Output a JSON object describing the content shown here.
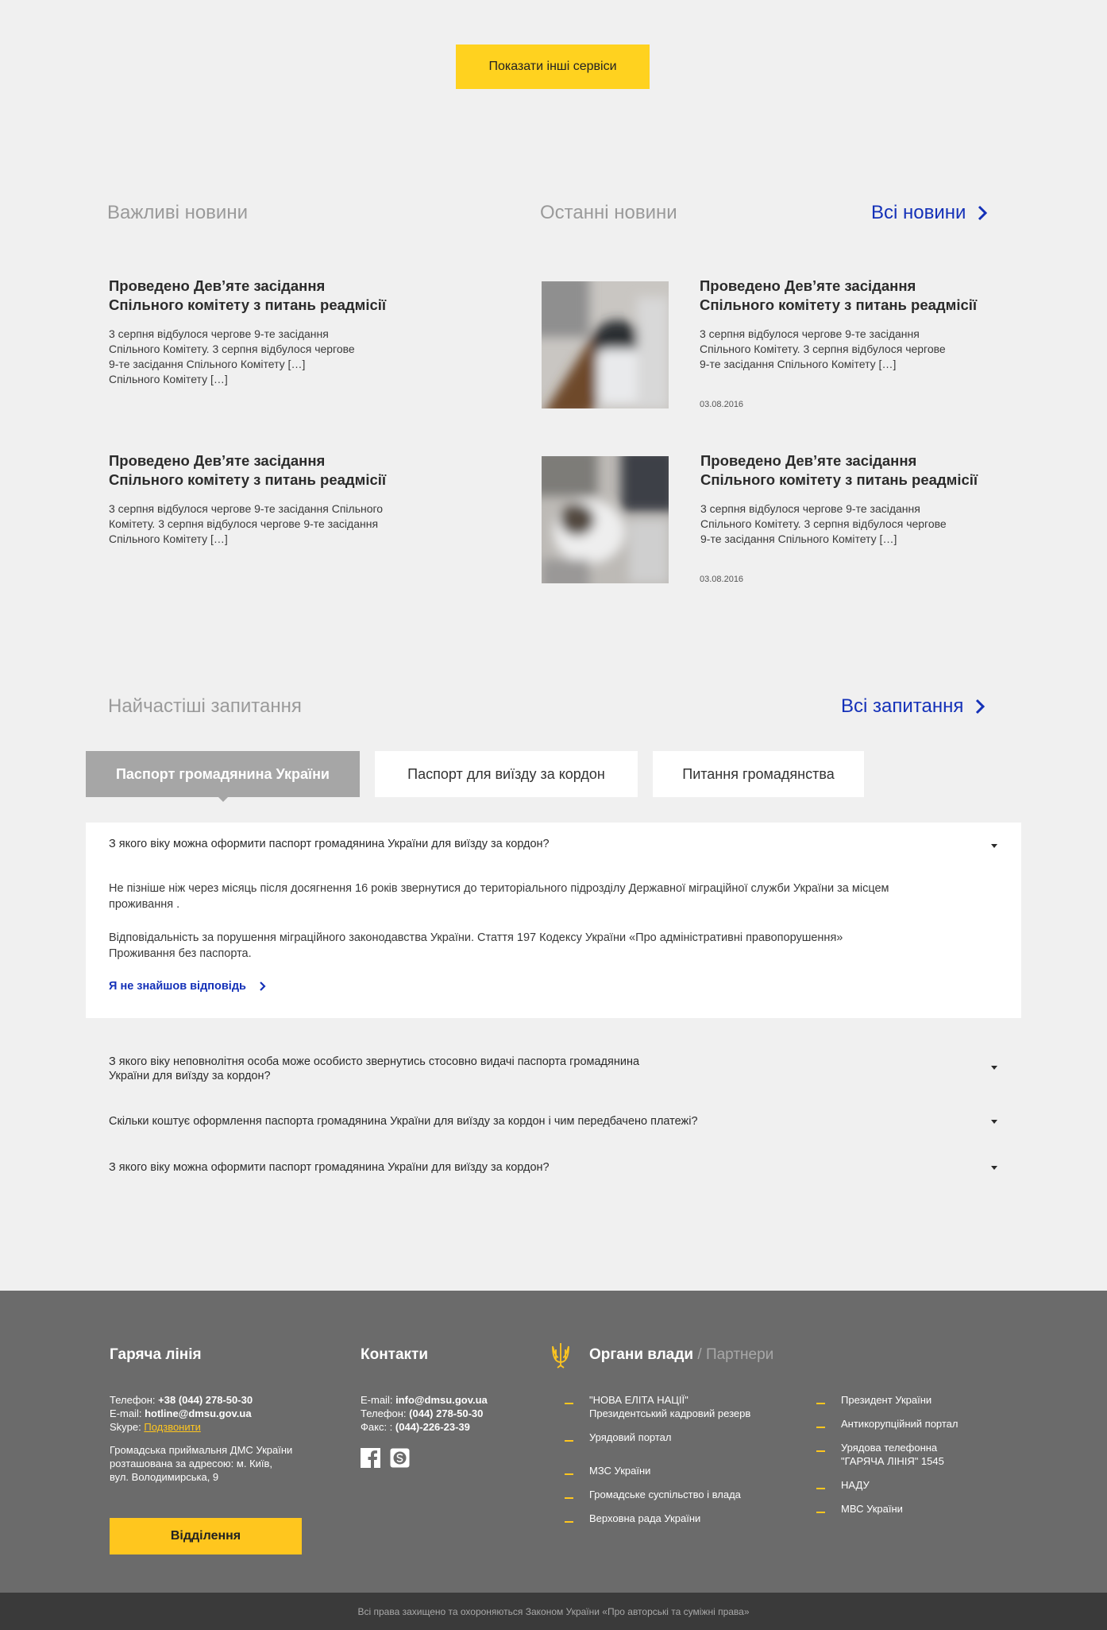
{
  "top": {
    "show_services_label": "Показати інші сервіси"
  },
  "news": {
    "important_title": "Важливі новини",
    "latest_title": "Останні новини",
    "all_news_label": "Всі новини",
    "important": [
      {
        "title_l1": "Проведено Дев’яте засідання",
        "title_l2": "Спільного комітету з питань реадмісії",
        "text": [
          "3 серпня відбулося чергове 9-те засідання",
          "Спільного Комітету. 3 серпня відбулося чергове",
          "9-те засідання Спільного Комітету […]",
          "Спільного Комітету […]"
        ]
      },
      {
        "title_l1": "Проведено Дев’яте засідання",
        "title_l2": "Спільного комітету з питань реадмісії",
        "text": [
          "3 серпня відбулося чергове 9-те засідання Спільного",
          "Комітету. 3 серпня відбулося чергове 9-те засідання",
          "Спільного Комітету […]"
        ]
      }
    ],
    "latest": [
      {
        "title_l1": "Проведено Дев’яте засідання",
        "title_l2": "Спільного комітету з питань реадмісії",
        "text": [
          "3 серпня відбулося чергове 9-те засідання",
          "Спільного Комітету. 3 серпня відбулося чергове",
          "9-те засідання Спільного Комітету […]"
        ],
        "date": "03.08.2016"
      },
      {
        "title_l1": "Проведено Дев’яте засідання",
        "title_l2": "Спільного комітету з питань реадмісії",
        "text": [
          "3 серпня відбулося чергове 9-те засідання",
          "Спільного Комітету. 3 серпня відбулося чергове",
          "9-те засідання Спільного Комітету  […]"
        ],
        "date": "03.08.2016"
      }
    ]
  },
  "faq": {
    "title": "Найчастіші запитання",
    "all_label": "Всі запитання",
    "tabs": [
      "Паспорт громадянина України",
      "Паспорт для виїзду за кордон",
      "Питання громадянства"
    ],
    "open": {
      "question": "З якого віку можна оформити паспорт громадянина України для виїзду за кордон?",
      "answer_l1": " Не пізніше ніж через місяць після досягнення 16 років звернутися до територіального підрозділу Державної міграційної служби України за місцем",
      "answer_l2": "проживання .",
      "answer_l3": "Відповідальність за порушення міграційного законодавства України. Стаття 197 Кодексу України «Про адміністративні правопорушення»",
      "answer_l4": "Проживання без паспорта.",
      "not_found": "Я не знайшов відповідь"
    },
    "closed": [
      {
        "l1": "З якого віку неповнолітня особа може особисто звернутись стосовно видачі паспорта громадянина",
        "l2": "України для виїзду за кордон?"
      },
      {
        "l1": "Скільки коштує оформлення паспорта громадянина України для виїзду за кордон і чим передбачено платежі?"
      },
      {
        "l1": "З якого віку можна оформити паспорт громадянина України для виїзду за кордон?"
      }
    ]
  },
  "footer": {
    "hotline": {
      "title": "Гаряча лінія",
      "phone_label": "Телефон: ",
      "phone": "+38 (044) 278-50-30",
      "email_label": "E-mail: ",
      "email": "hotline@dmsu.gov.ua",
      "skype_label": "Skype: ",
      "skype": "Подзвонити",
      "addr": [
        "Громадська приймальня ДМС України",
        "розташована за адресою: м. Київ,",
        "вул. Володимирська, 9"
      ],
      "button": "Відділення"
    },
    "contacts": {
      "title": "Контакти",
      "email_label": "E-mail: ",
      "email": "info@dmsu.gov.ua",
      "phone_label": "Телефон: ",
      "phone": "(044) 278-50-30",
      "fax_label": "Факс: : ",
      "fax": "(044)-226-23-39"
    },
    "authorities": {
      "title": "Органи влади",
      "sep": " / ",
      "partners": "Партнери",
      "col1": [
        {
          "l1": "\"НОВА ЕЛІТА НАЦІЇ\"",
          "l2": "Президентський кадровий резерв"
        },
        {
          "l1": "Урядовий портал"
        },
        {
          "l1": "МЗС України"
        },
        {
          "l1": "Громадське суспільство і влада"
        },
        {
          "l1": "Верховна рада України"
        }
      ],
      "col2": [
        {
          "l1": "Президент України"
        },
        {
          "l1": "Антикорупційний портал"
        },
        {
          "l1": "Урядова телефонна",
          "l2": "\"ГАРЯЧА ЛІНІЯ\" 1545"
        },
        {
          "l1": "НАДУ"
        },
        {
          "l1": "МВС України"
        }
      ]
    },
    "copyright": "Всі права захищено та охороняються Законом України «Про авторські та суміжні права»"
  },
  "colors": {
    "accent": "#ffd21f",
    "link": "#1431b8",
    "footer_bg": "#6b6b6b"
  }
}
